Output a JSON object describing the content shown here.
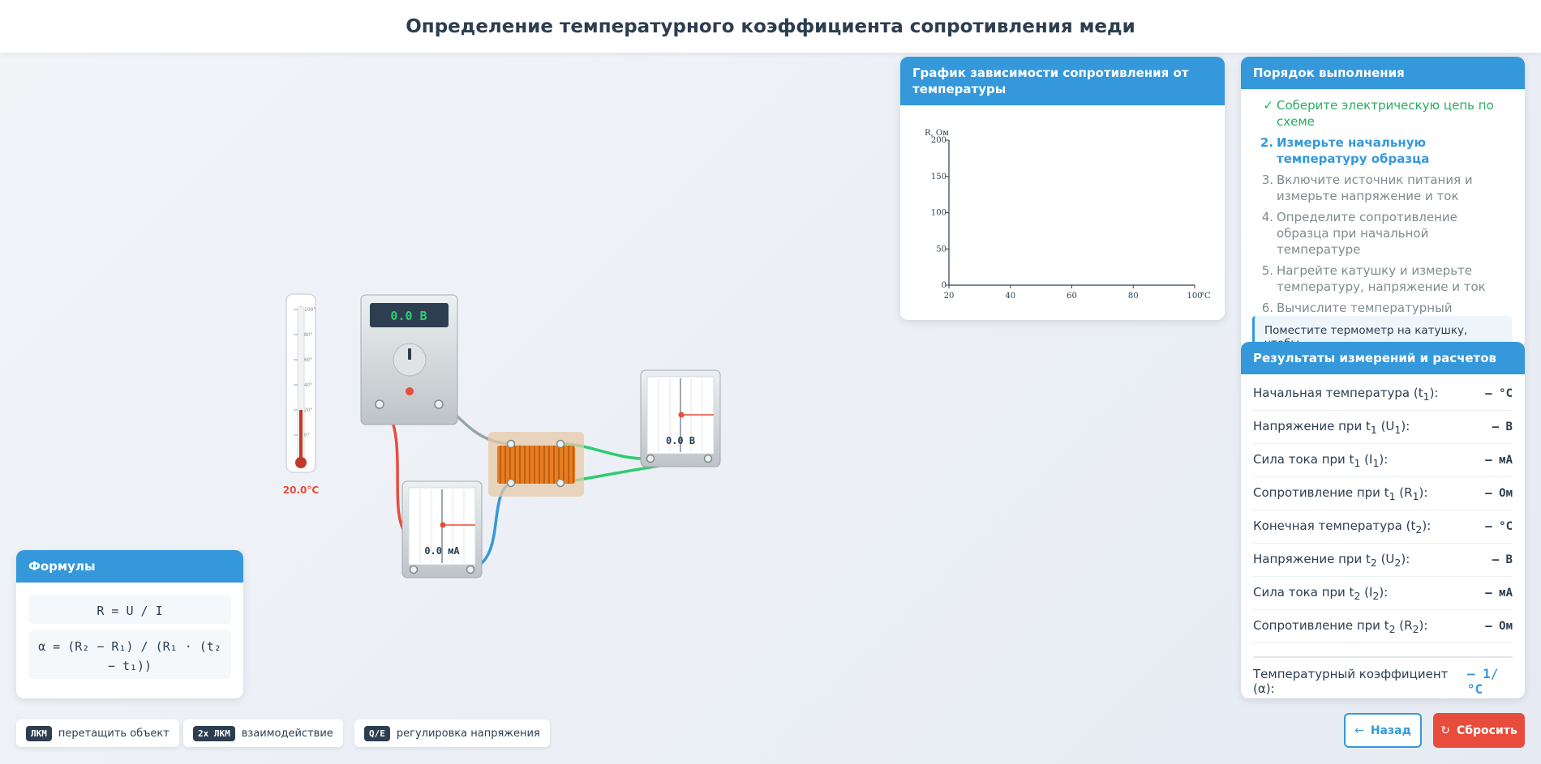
{
  "title": "Определение температурного коэффициента сопротивления меди",
  "graph": {
    "header": "График зависимости сопротивления от температуры"
  },
  "chart_data": {
    "type": "line",
    "title": "",
    "xlabel": "°C",
    "ylabel": "R, Ом",
    "xlim": [
      20,
      100
    ],
    "ylim": [
      0,
      200
    ],
    "x_ticks": [
      "20",
      "40",
      "60",
      "80",
      "100"
    ],
    "y_ticks": [
      "0",
      "50",
      "100",
      "150",
      "200"
    ],
    "series": [],
    "grid": false
  },
  "steps": {
    "header": "Порядок выполнения",
    "items": [
      {
        "num": "✓",
        "text": "Соберите электрическую цепь по схеме",
        "state": "done"
      },
      {
        "num": "2.",
        "text": "Измерьте начальную температуру образца",
        "state": "active"
      },
      {
        "num": "3.",
        "text": "Включите источник питания и измерьте напряжение и ток",
        "state": "pending"
      },
      {
        "num": "4.",
        "text": "Определите сопротивление образца при начальной температуре",
        "state": "pending"
      },
      {
        "num": "5.",
        "text": "Нагрейте катушку и измерьте температуру, напряжение и ток",
        "state": "pending"
      },
      {
        "num": "6.",
        "text": "Вычислите температурный коэффициент сопротивления меди",
        "state": "pending"
      }
    ],
    "hint": "Поместите термометр на катушку, чтобы"
  },
  "results": {
    "header": "Результаты измерений и расчетов",
    "rows": [
      {
        "label": "Начальная температура (t",
        "sub": "1",
        "tail": "):",
        "value": "– °C"
      },
      {
        "label": "Напряжение при t",
        "sub": "1",
        "tail": " (U",
        "sub2": "1",
        "tail2": "):",
        "value": "– В"
      },
      {
        "label": "Сила тока при t",
        "sub": "1",
        "tail": " (I",
        "sub2": "1",
        "tail2": "):",
        "value": "– мА"
      },
      {
        "label": "Сопротивление при t",
        "sub": "1",
        "tail": " (R",
        "sub2": "1",
        "tail2": "):",
        "value": "– Ом"
      },
      {
        "label": "Конечная температура (t",
        "sub": "2",
        "tail": "):",
        "value": "– °C"
      },
      {
        "label": "Напряжение при t",
        "sub": "2",
        "tail": " (U",
        "sub2": "2",
        "tail2": "):",
        "value": "– В"
      },
      {
        "label": "Сила тока при t",
        "sub": "2",
        "tail": " (I",
        "sub2": "2",
        "tail2": "):",
        "value": "– мА"
      },
      {
        "label": "Сопротивление при t",
        "sub": "2",
        "tail": " (R",
        "sub2": "2",
        "tail2": "):",
        "value": "– Ом"
      }
    ],
    "coef_label": "Температурный коэффициент (α):",
    "coef_value": "– 1/°C"
  },
  "formulas": {
    "header": "Формулы",
    "f1": "R = U / I",
    "f2": "α = (R₂ − R₁) / (R₁ · (t₂ − t₁))"
  },
  "instruments": {
    "thermometer_reading": "20.0°C",
    "thermometer_scale": [
      "100°",
      "80°",
      "60°",
      "40°",
      "20°",
      "0°"
    ],
    "thermometer_level": 20,
    "power_display": "0.0 В",
    "voltmeter_display": "0.0 В",
    "ammeter_display": "0.0 мА"
  },
  "hints": [
    {
      "key": "ЛКМ",
      "text": "перетащить объект"
    },
    {
      "key": "2x ЛКМ",
      "text": "взаимодействие"
    },
    {
      "key": "Q/E",
      "text": "регулировка напряжения"
    }
  ],
  "buttons": {
    "back": "Назад",
    "reset": "Сбросить"
  },
  "colors": {
    "accent": "#3498db",
    "danger": "#e74c3c",
    "success": "#27ae60",
    "coil": "#e67e22",
    "wire_red": "#e74c3c",
    "wire_green": "#2ecc71",
    "wire_blue": "#3498db",
    "wire_gray": "#95a5a6"
  }
}
